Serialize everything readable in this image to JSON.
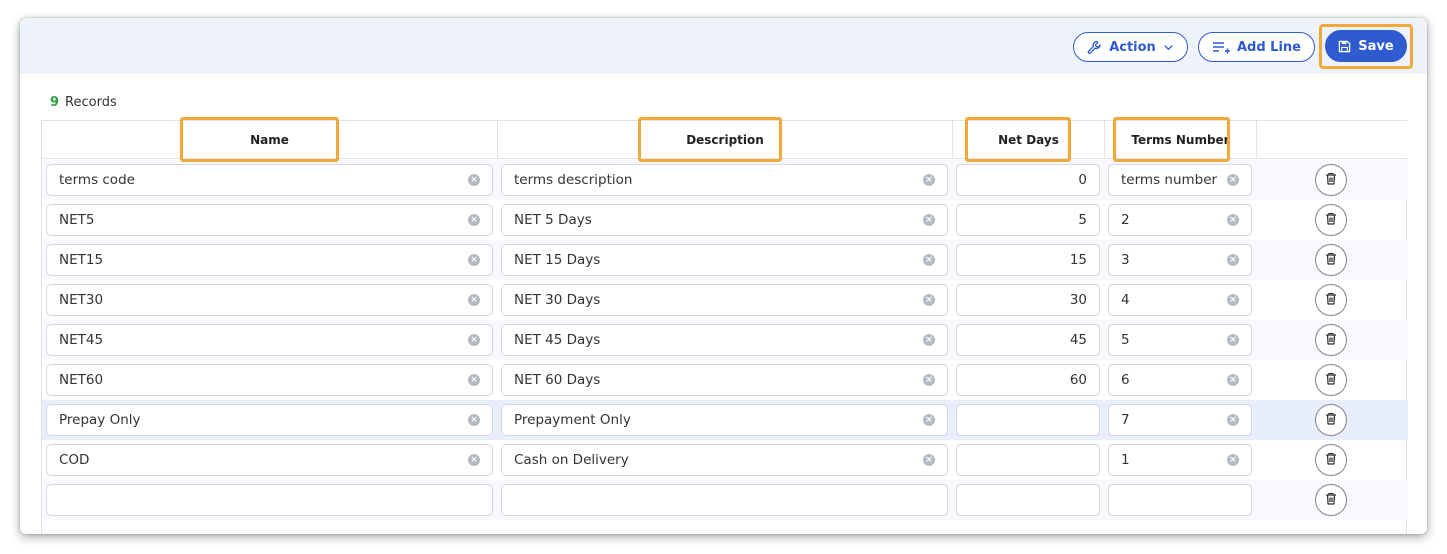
{
  "toolbar": {
    "action_label": "Action",
    "add_line_label": "Add Line",
    "save_label": "Save"
  },
  "records": {
    "count": "9",
    "label": "Records"
  },
  "columns": [
    "Name",
    "Description",
    "Net Days",
    "Terms Number"
  ],
  "rows": [
    {
      "name": "terms code",
      "description": "terms description",
      "net_days": "0",
      "terms_number": "terms number"
    },
    {
      "name": "NET5",
      "description": "NET 5 Days",
      "net_days": "5",
      "terms_number": "2"
    },
    {
      "name": "NET15",
      "description": "NET 15 Days",
      "net_days": "15",
      "terms_number": "3"
    },
    {
      "name": "NET30",
      "description": "NET 30 Days",
      "net_days": "30",
      "terms_number": "4"
    },
    {
      "name": "NET45",
      "description": "NET 45 Days",
      "net_days": "45",
      "terms_number": "5"
    },
    {
      "name": "NET60",
      "description": "NET 60 Days",
      "net_days": "60",
      "terms_number": "6"
    },
    {
      "name": "Prepay Only",
      "description": "Prepayment Only",
      "net_days": "",
      "terms_number": "7"
    },
    {
      "name": "COD",
      "description": "Cash on Delivery",
      "net_days": "",
      "terms_number": "1"
    },
    {
      "name": "",
      "description": "",
      "net_days": "",
      "terms_number": ""
    }
  ],
  "colors": {
    "primary": "#2f5bd0",
    "highlight": "#f2a83b",
    "records_count": "#2e9e3b",
    "toolbar_bg": "#eef2fb",
    "selected_row": "#e8eefb"
  },
  "icons": {
    "action": "wrench-icon",
    "action_caret": "chevron-down-icon",
    "add_line": "list-add-icon",
    "save": "floppy-disk-icon",
    "clear": "clear-x-icon",
    "delete": "trash-icon"
  }
}
